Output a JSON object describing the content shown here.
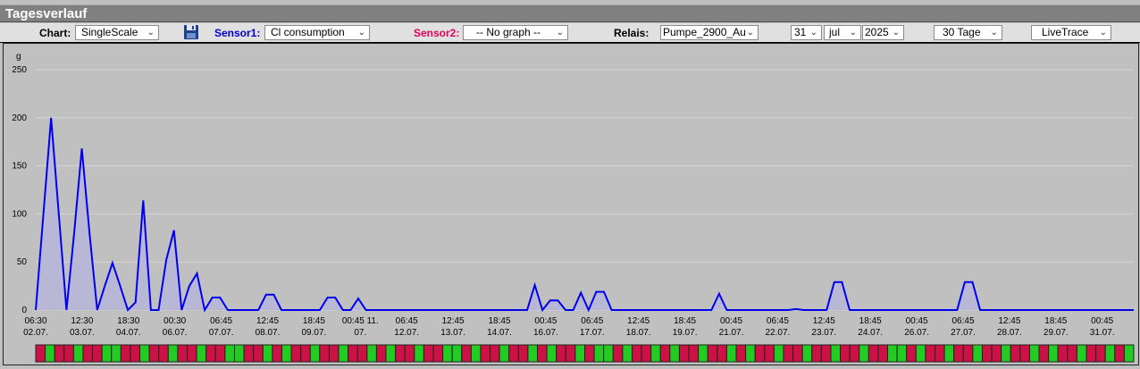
{
  "window": {
    "title": "Tagesverlauf"
  },
  "toolbar": {
    "chart_label": "Chart:",
    "chart_value": "SingleScale",
    "save_icon": "floppy-save-icon",
    "sensor1_label": "Sensor1:",
    "sensor1_value": "Cl consumption",
    "sensor2_label": "Sensor2:",
    "sensor2_value": "-- No graph --",
    "relais_label": "Relais:",
    "relais_value": "Pumpe_2900_Au",
    "day_value": "31",
    "month_value": "jul",
    "year_value": "2025",
    "range_value": "30 Tage",
    "mode_value": "LiveTrace",
    "colors": {
      "sensor1": "#0000cc",
      "sensor2": "#e0005a"
    }
  },
  "chart_data": {
    "type": "area",
    "ylabel": "g",
    "ylim": [
      0,
      250
    ],
    "yticks": [
      0,
      50,
      100,
      150,
      200,
      250
    ],
    "xticks": [
      [
        "06:30",
        "02.07."
      ],
      [
        "12:30",
        "03.07."
      ],
      [
        "18:30",
        "04.07."
      ],
      [
        "00:30",
        "06.07."
      ],
      [
        "06:45",
        "07.07."
      ],
      [
        "12:45",
        "08.07."
      ],
      [
        "18:45",
        "09.07."
      ],
      [
        "00:45 11.",
        "07."
      ],
      [
        "06:45",
        "12.07."
      ],
      [
        "12:45",
        "13.07."
      ],
      [
        "18:45",
        "14.07."
      ],
      [
        "00:45",
        "16.07."
      ],
      [
        "06:45",
        "17.07."
      ],
      [
        "12:45",
        "18.07."
      ],
      [
        "18:45",
        "19.07."
      ],
      [
        "00:45",
        "21.07."
      ],
      [
        "06:45",
        "22.07."
      ],
      [
        "12:45",
        "23.07."
      ],
      [
        "18:45",
        "24.07."
      ],
      [
        "00:45",
        "26.07."
      ],
      [
        "06:45",
        "27.07."
      ],
      [
        "12:45",
        "28.07."
      ],
      [
        "18:45",
        "29.07."
      ],
      [
        "00:45",
        "31.07."
      ]
    ],
    "series": [
      {
        "color": "#0000ee",
        "values": [
          0,
          100,
          200,
          100,
          0,
          80,
          168,
          80,
          0,
          25,
          49,
          25,
          0,
          8,
          114,
          0,
          0,
          52,
          83,
          0,
          25,
          38,
          0,
          13,
          13,
          0,
          0,
          0,
          0,
          0,
          16,
          16,
          0,
          0,
          0,
          0,
          0,
          0,
          13,
          13,
          0,
          0,
          12,
          0,
          0,
          0,
          0,
          0,
          0,
          0,
          0,
          0,
          0,
          0,
          0,
          0,
          0,
          0,
          0,
          0,
          0,
          0,
          0,
          0,
          0,
          26,
          0,
          10,
          10,
          0,
          0,
          18,
          0,
          19,
          19,
          0,
          0,
          0,
          0,
          0,
          0,
          0,
          0,
          0,
          0,
          0,
          0,
          0,
          0,
          17,
          0,
          0,
          0,
          0,
          0,
          0,
          0,
          0,
          0,
          1,
          0,
          0,
          0,
          0,
          29,
          29,
          0,
          0,
          0,
          0,
          0,
          0,
          0,
          0,
          0,
          0,
          0,
          0,
          0,
          0,
          0,
          29,
          29,
          0,
          0,
          0,
          0,
          0,
          0,
          0,
          0,
          0,
          0,
          0,
          0,
          0,
          0,
          0,
          0,
          0,
          0,
          0,
          0,
          0
        ]
      }
    ],
    "relay_states": "RGRRGRRGGRRGRRGRRGRRGGRRGRGRRGRRGRRGRGRRGRRGGRGRRGRRGRGRRGRGGRGRRGRGRRGRRGRGRRGRRGRRGRRGRRGGRGRRGRRGRRGRRGRGRRGRRGRG"
  }
}
